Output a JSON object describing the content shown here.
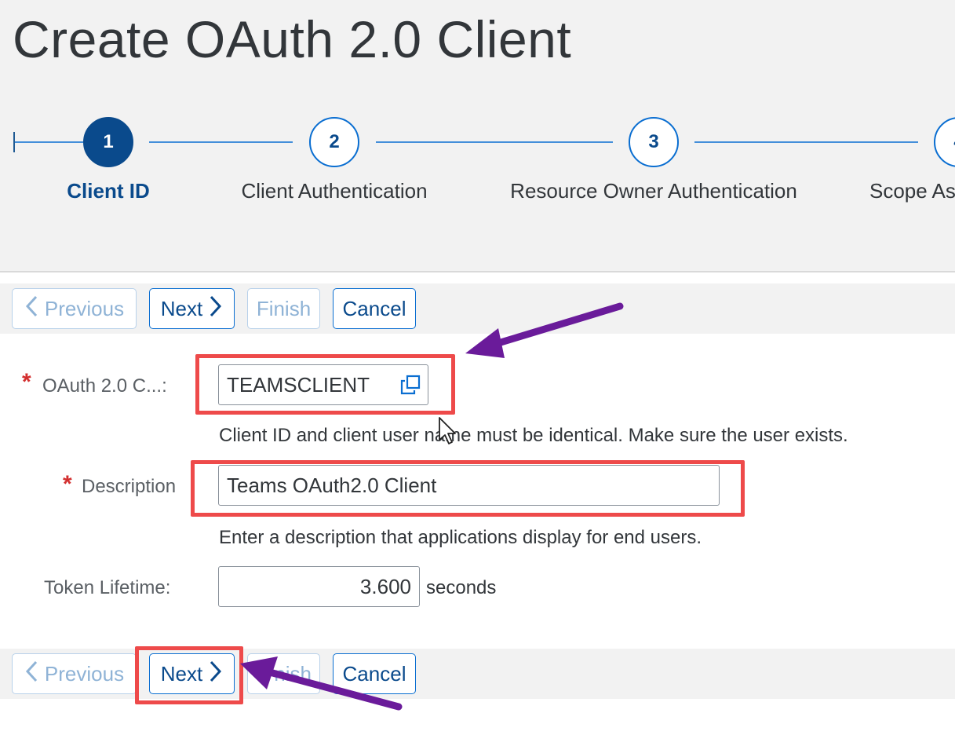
{
  "page": {
    "title": "Create OAuth 2.0 Client"
  },
  "wizard": {
    "steps": [
      {
        "number": "1",
        "label": "Client ID",
        "active": true
      },
      {
        "number": "2",
        "label": "Client Authentication",
        "active": false
      },
      {
        "number": "3",
        "label": "Resource Owner Authentication",
        "active": false
      },
      {
        "number": "4",
        "label": "Scope As",
        "active": false
      }
    ]
  },
  "toolbar": {
    "previous_label": "Previous",
    "next_label": "Next",
    "finish_label": "Finish",
    "cancel_label": "Cancel"
  },
  "form": {
    "client_id": {
      "label": "OAuth 2.0 C...:",
      "required": true,
      "value": "TEAMSCLIENT",
      "hint": "Client ID and client user name must be identical. Make sure the user exists."
    },
    "description": {
      "label": "Description",
      "required": true,
      "value": "Teams OAuth2.0 Client",
      "hint": "Enter a description that applications display for end users."
    },
    "token_lifetime": {
      "label": "Token Lifetime:",
      "value": "3.600",
      "unit": "seconds"
    }
  },
  "bottom_toolbar": {
    "previous_label": "Previous",
    "next_label": "Next",
    "finish_label": "nish",
    "cancel_label": "Cancel"
  },
  "icons": {
    "copy": "copy-icon",
    "chevron_left": "chevron-left-icon",
    "chevron_right": "chevron-right-icon",
    "required_asterisk": "*"
  },
  "colors": {
    "accent": "#0a6ed1",
    "brand_dark": "#0a4a8c",
    "highlight": "#ee4a4a",
    "annotation_arrow": "#6a1b9a",
    "required": "#d32f2f"
  }
}
